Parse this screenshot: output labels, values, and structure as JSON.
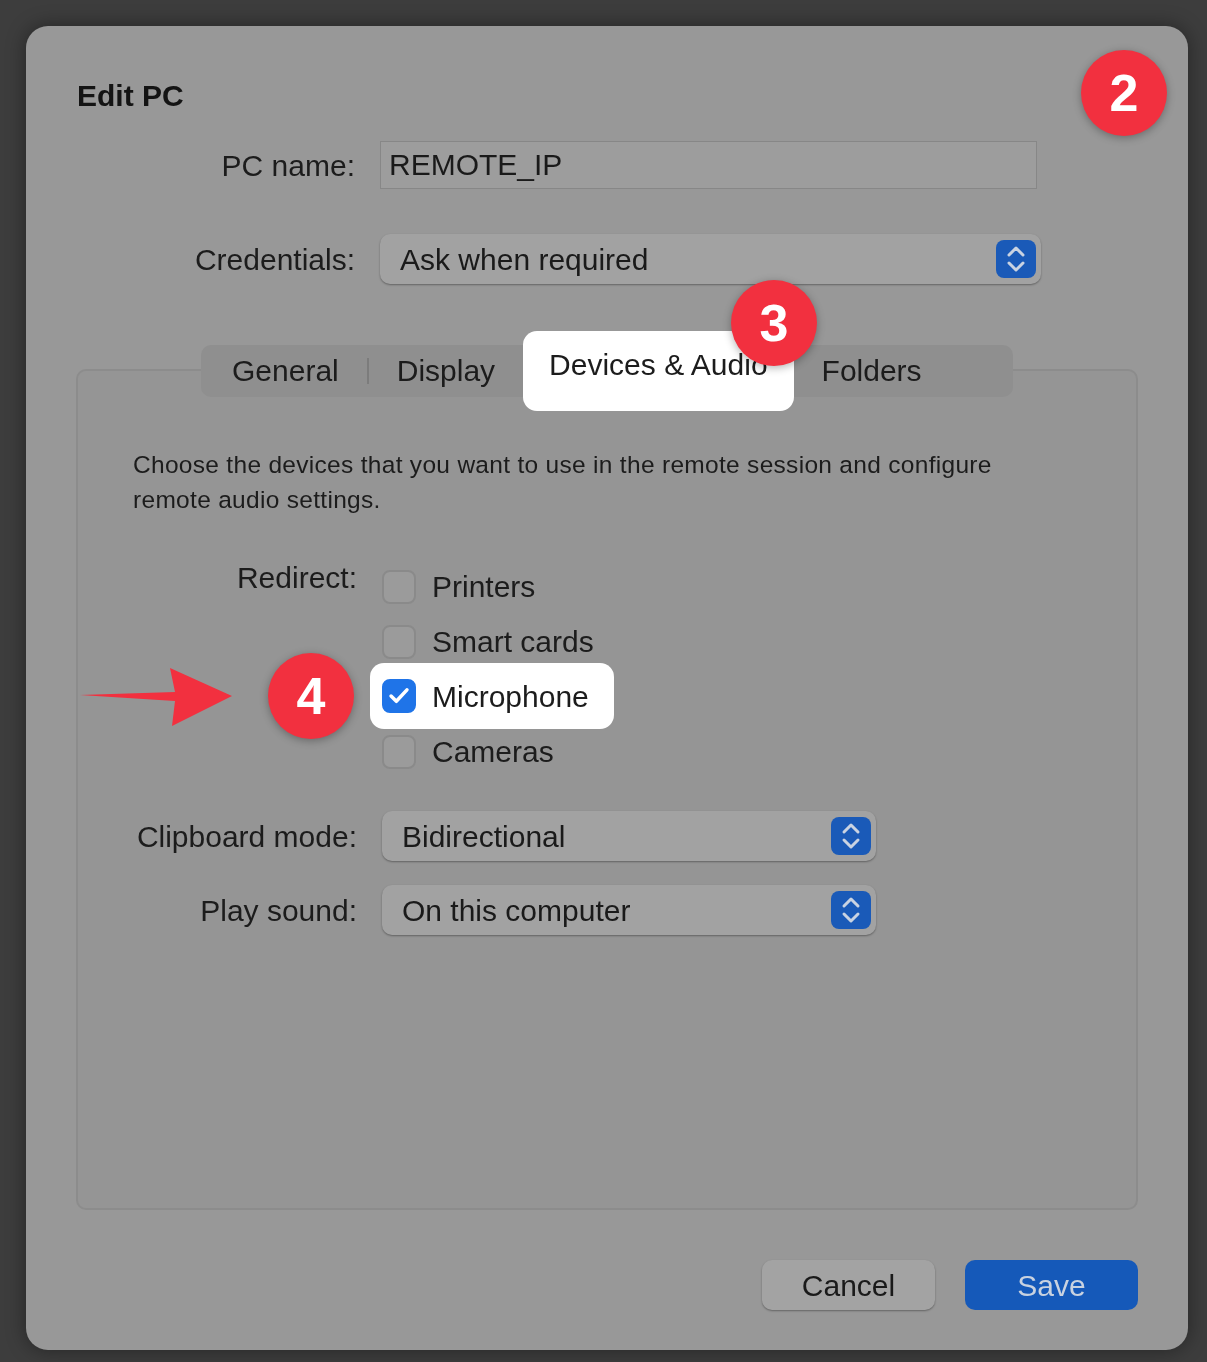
{
  "dialog": {
    "title": "Edit PC",
    "badge": "2",
    "pc_name": {
      "label": "PC name:",
      "value": "REMOTE_IP"
    },
    "credentials": {
      "label": "Credentials:",
      "value": "Ask when required"
    },
    "tabs": [
      {
        "label": "General",
        "selected": false
      },
      {
        "label": "Display",
        "selected": false
      },
      {
        "label": "Devices & Audio",
        "selected": true,
        "badge": "3"
      },
      {
        "label": "Folders",
        "selected": false
      }
    ],
    "description": "Choose the devices that you want to use in the remote session and configure remote audio settings.",
    "redirect": {
      "label": "Redirect:",
      "options": [
        {
          "label": "Printers",
          "checked": false,
          "highlighted": false
        },
        {
          "label": "Smart cards",
          "checked": false,
          "highlighted": false
        },
        {
          "label": "Microphone",
          "checked": true,
          "highlighted": true,
          "badge": "4",
          "arrow": true
        },
        {
          "label": "Cameras",
          "checked": false,
          "highlighted": false
        }
      ]
    },
    "clipboard_mode": {
      "label": "Clipboard mode:",
      "value": "Bidirectional"
    },
    "play_sound": {
      "label": "Play sound:",
      "value": "On this computer"
    },
    "buttons": [
      {
        "label": "Cancel",
        "kind": "secondary"
      },
      {
        "label": "Save",
        "kind": "primary"
      }
    ]
  }
}
